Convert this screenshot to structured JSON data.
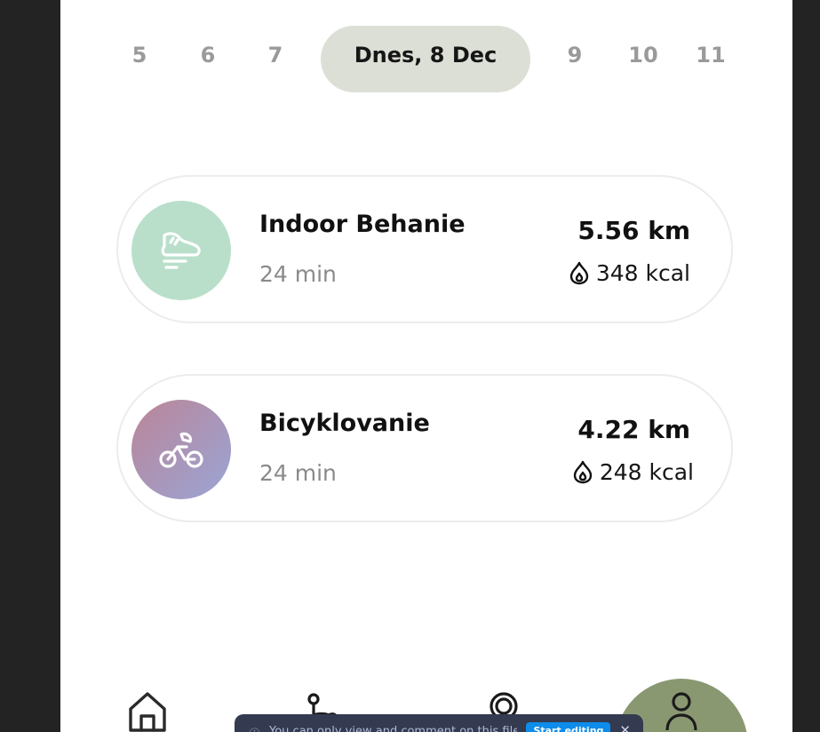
{
  "dates": {
    "before": [
      "5",
      "6",
      "7"
    ],
    "selected": "Dnes, 8 Dec",
    "after": [
      "9",
      "10",
      "11"
    ]
  },
  "activities": [
    {
      "title": "Indoor Behanie",
      "duration": "24 min",
      "distance": "5.56 km",
      "kcal": "348 kcal",
      "icon": "running-shoe-icon",
      "color": "#b9dfcb"
    },
    {
      "title": "Bicyklovanie",
      "duration": "24 min",
      "distance": "4.22 km",
      "kcal": "248 kcal",
      "icon": "cyclist-icon",
      "color_from": "#bb8598",
      "color_to": "#9aa5d6"
    }
  ],
  "nav": {
    "items": [
      "home-icon",
      "workout-icon",
      "goal-icon",
      "profile-icon"
    ],
    "active": "profile-icon",
    "active_color": "#8a9872"
  },
  "toast": {
    "text": "You can only view and comment on this file.",
    "button": "Start editing"
  }
}
